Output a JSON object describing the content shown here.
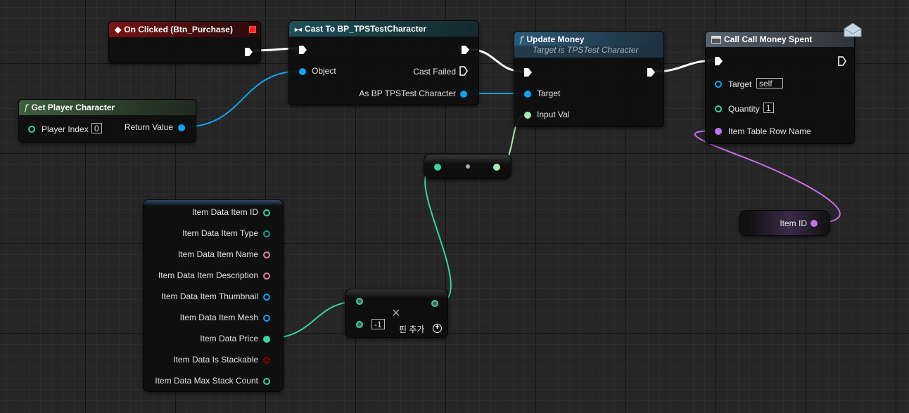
{
  "colors": {
    "exec": "#ffffff",
    "object_pin": "#0fa3f5",
    "float_pin": "#2fd8a0",
    "float_in_pin": "#a8e6b2",
    "name_pin": "#c571f0",
    "struct_link": "#1a9b8a",
    "string_pin": "#e37fa6",
    "bool_pin": "#8b0000"
  },
  "nodes": {
    "on_clicked": {
      "title": "On Clicked (Btn_Purchase)",
      "icon": "event-diamond-icon"
    },
    "cast": {
      "title": "Cast To BP_TPSTestCharacter",
      "object_label": "Object",
      "cast_failed_label": "Cast Failed",
      "as_label": "As BP TPSTest Character"
    },
    "get_player": {
      "title": "Get Player Character",
      "player_index_label": "Player Index",
      "player_index_value": "0",
      "return_label": "Return Value"
    },
    "update_money": {
      "title": "Update Money",
      "subtitle": "Target is TPSTest Character",
      "target_label": "Target",
      "input_label": "Input Val"
    },
    "call_money_spent": {
      "title": "Call Call Money Spent",
      "target_label": "Target",
      "target_value": "self",
      "quantity_label": "Quantity",
      "quantity_value": "1",
      "row_label": "Item Table Row Name"
    },
    "item_id": {
      "label": "Item ID"
    },
    "break_struct": {
      "items": [
        "Item Data Item ID",
        "Item Data Item Type",
        "Item Data Item Name",
        "Item Data Item Description",
        "Item Data Item Thumbnail",
        "Item Data Item Mesh",
        "Item Data Price",
        "Item Data Is Stackable",
        "Item Data Max Stack Count"
      ]
    },
    "multiply": {
      "operator": "×",
      "value": "-1",
      "add_pin_label": "핀 추가"
    }
  }
}
